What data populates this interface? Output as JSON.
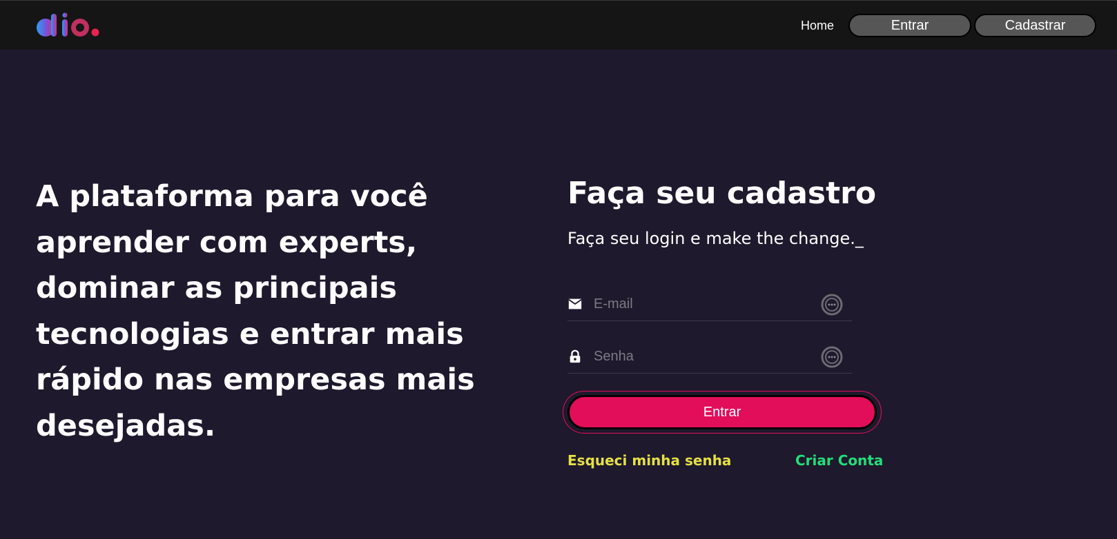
{
  "header": {
    "logo_alt": "dio",
    "nav": {
      "home_label": "Home",
      "login_label": "Entrar",
      "signup_label": "Cadastrar"
    }
  },
  "hero": {
    "headline": "A plataforma para você aprender com experts, dominar as principais tecnologias e entrar mais rápido nas empresas mais desejadas."
  },
  "form": {
    "title": "Faça seu cadastro",
    "subtitle": "Faça seu login e make the change._",
    "email": {
      "placeholder": "E-mail",
      "value": "",
      "icon": "mail-icon"
    },
    "password": {
      "placeholder": "Senha",
      "value": "",
      "icon": "lock-icon"
    },
    "submit_label": "Entrar",
    "forgot_label": "Esqueci minha senha",
    "create_label": "Criar Conta"
  },
  "colors": {
    "background": "#1e192c",
    "topbar": "#151515",
    "accent": "#e20e5a",
    "forgot_link": "#e5e044",
    "create_link": "#23dd7a",
    "nav_button": "#565656"
  }
}
